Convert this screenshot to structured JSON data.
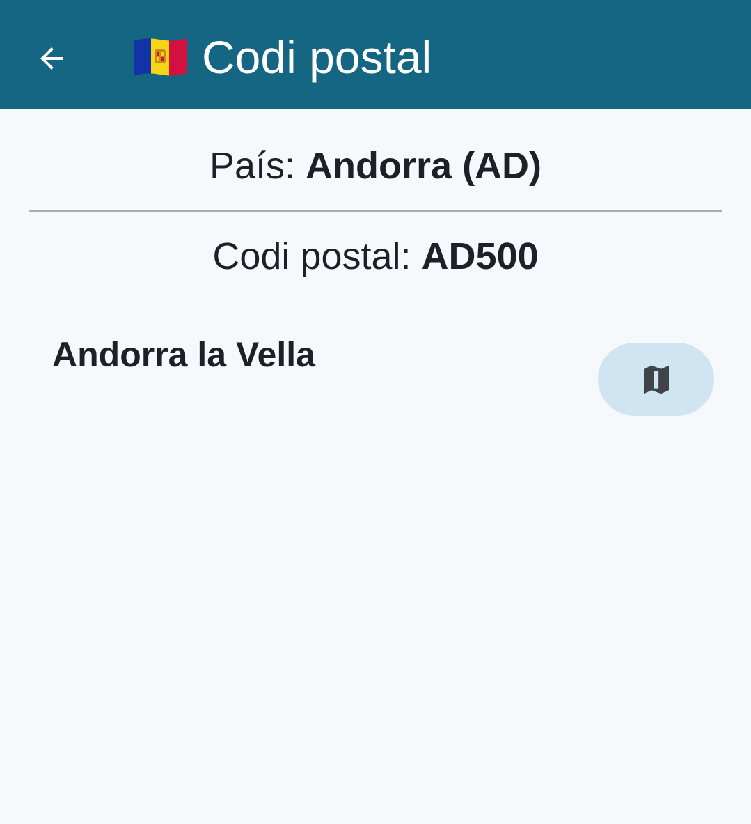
{
  "appbar": {
    "title": "Codi postal",
    "back_icon": "arrow-left-icon",
    "flag_icon": "andorra-flag-icon",
    "background_color": "#146682"
  },
  "country": {
    "label": "País:",
    "value": "Andorra (AD)"
  },
  "postal_code": {
    "label": "Codi postal:",
    "value": "AD500"
  },
  "places": [
    {
      "name": "Andorra la Vella",
      "action_icon": "map-icon"
    }
  ]
}
